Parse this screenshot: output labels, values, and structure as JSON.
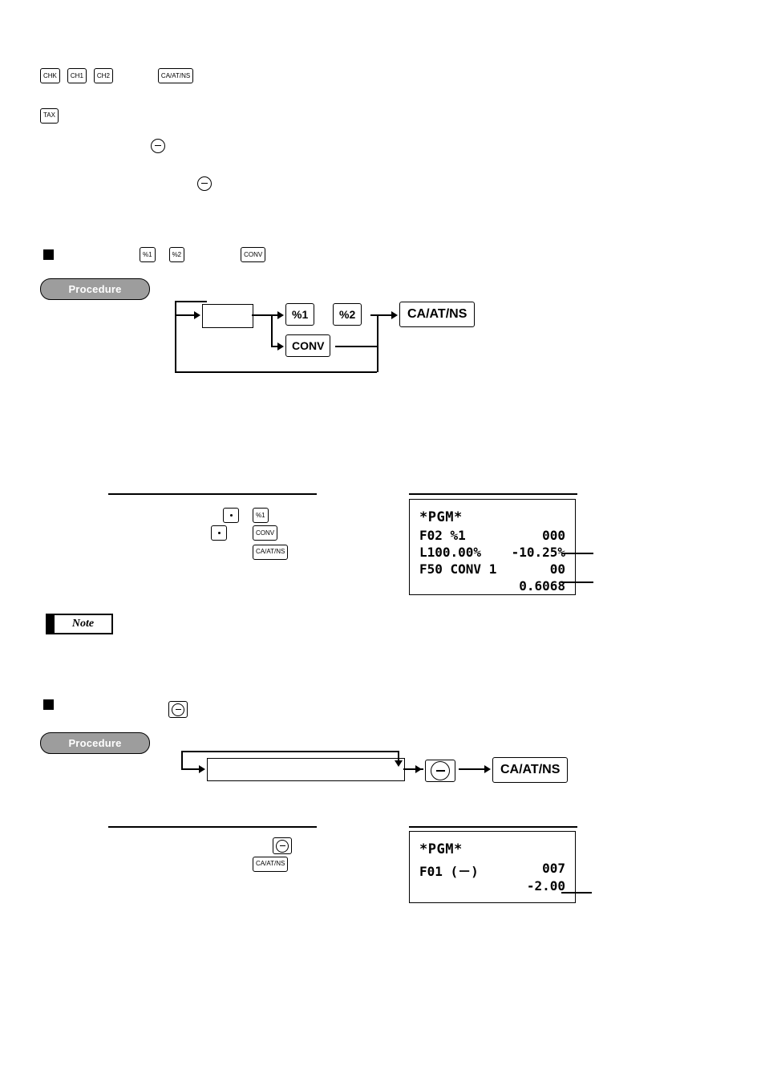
{
  "top_keys": {
    "row1": [
      "CHK",
      "CH1",
      "CH2",
      "CA/AT/NS"
    ],
    "row2": [
      "TAX"
    ],
    "minus_icon_1": "circle-minus-icon",
    "minus_icon_2": "circle-minus-icon"
  },
  "section1": {
    "keys": [
      "%1",
      "%2",
      "CONV"
    ],
    "procedure_label": "Procedure",
    "flow": {
      "key_pct1": "%1",
      "key_pct2": "%2",
      "key_conv": "CONV",
      "key_total": "CA/AT/NS"
    },
    "example": {
      "dot_key": "·",
      "dot_key_2": "·",
      "key_pct1": "%1",
      "key_conv": "CONV",
      "key_total": "CA/AT/NS"
    },
    "lcd": {
      "title": "*PGM*",
      "lines": [
        {
          "left": "F02 %1",
          "right": "000"
        },
        {
          "left": "L100.00%",
          "right": "-10.25%"
        },
        {
          "left": "F50 CONV 1",
          "right": "00"
        },
        {
          "left": "",
          "right": "0.6068"
        }
      ]
    }
  },
  "note": {
    "bar": "note-bar",
    "label": "Note"
  },
  "section2": {
    "key_minus": "circle-minus-icon",
    "procedure_label": "Procedure",
    "flow": {
      "key_minus": "circle-minus-icon",
      "key_total": "CA/AT/NS"
    },
    "example": {
      "key_minus": "circle-minus-icon",
      "key_total": "CA/AT/NS"
    },
    "lcd": {
      "title": "*PGM*",
      "lines": [
        {
          "left": "F01 (－)",
          "right": "007"
        },
        {
          "left": "",
          "right": "-2.00"
        }
      ]
    }
  }
}
